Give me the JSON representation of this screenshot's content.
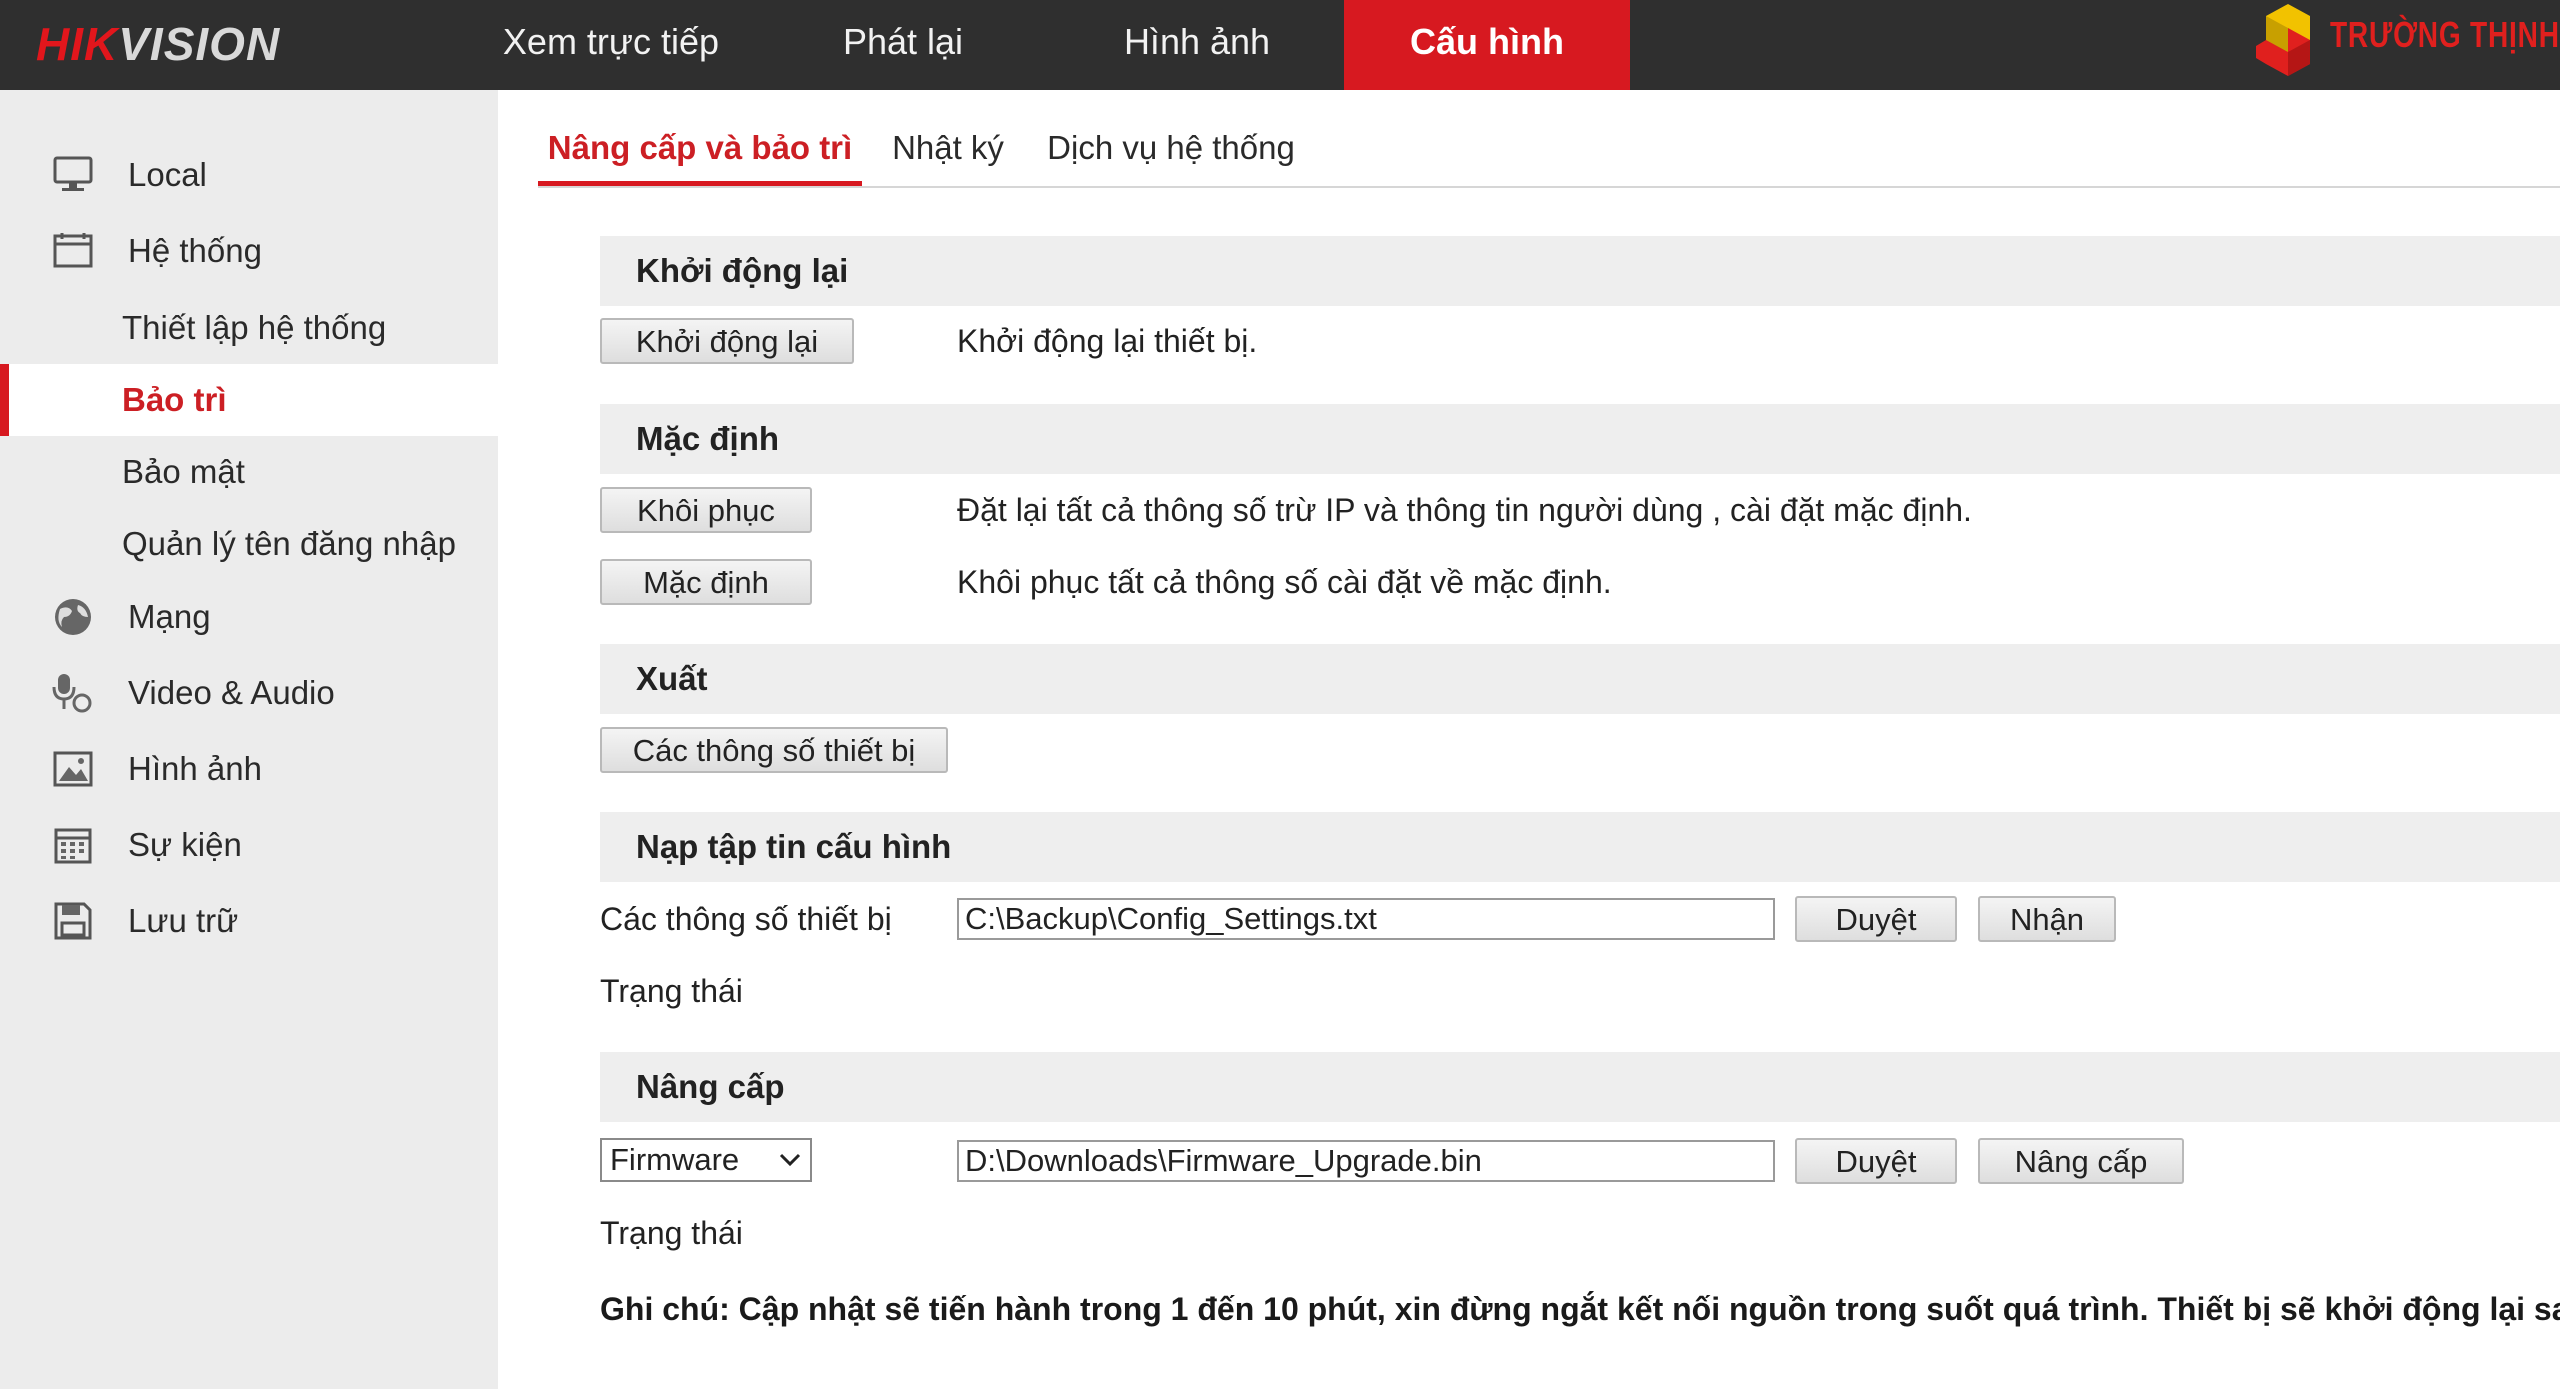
{
  "header": {
    "logo_part1": "HIK",
    "logo_part2": "VISION",
    "nav": [
      {
        "label": "Xem trực tiếp"
      },
      {
        "label": "Phát lại"
      },
      {
        "label": "Hình ảnh"
      },
      {
        "label": "Cấu hình",
        "active": true
      }
    ],
    "brand_text": "TRƯỜNG THỊNH",
    "accent_color": "#d71920"
  },
  "sidebar": {
    "items": [
      {
        "label": "Local",
        "icon": "monitor-icon"
      },
      {
        "label": "Hệ thống",
        "icon": "system-icon"
      },
      {
        "label": "Thiết lập hệ thống"
      },
      {
        "label": "Bảo trì",
        "active": true
      },
      {
        "label": "Bảo mật"
      },
      {
        "label": "Quản lý tên đăng nhập"
      },
      {
        "label": "Mạng",
        "icon": "globe-icon"
      },
      {
        "label": "Video & Audio",
        "icon": "mic-icon"
      },
      {
        "label": "Hình ảnh",
        "icon": "image-icon"
      },
      {
        "label": "Sự kiện",
        "icon": "calendar-icon"
      },
      {
        "label": "Lưu trữ",
        "icon": "storage-icon"
      }
    ]
  },
  "tabs": [
    {
      "label": "Nâng cấp và bảo trì",
      "active": true
    },
    {
      "label": "Nhật ký"
    },
    {
      "label": "Dịch vụ hệ thống"
    }
  ],
  "reboot": {
    "title": "Khởi động lại",
    "button": "Khởi động lại",
    "description": "Khởi động lại thiết bị."
  },
  "default": {
    "title": "Mặc định",
    "restore_button": "Khôi phục",
    "restore_desc": "Đặt lại tất cả thông số trừ IP và thông tin người dùng , cài đặt mặc định.",
    "default_button": "Mặc định",
    "default_desc": "Khôi phục tất cả thông số cài đặt về mặc định."
  },
  "export": {
    "title": "Xuất",
    "button": "Các thông số thiết bị"
  },
  "import": {
    "title": "Nạp tập tin cấu hình",
    "label": "Các thông số thiết bị",
    "file_value": "C:\\Backup\\Config_Settings.txt",
    "browse_button": "Duyệt",
    "import_button": "Nhận",
    "status_label": "Trạng thái"
  },
  "upgrade": {
    "title": "Nâng cấp",
    "select_value": "Firmware",
    "file_value": "D:\\Downloads\\Firmware_Upgrade.bin",
    "browse_button": "Duyệt",
    "upgrade_button": "Nâng cấp",
    "status_label": "Trạng thái"
  },
  "note": "Ghi chú: Cập nhật sẽ tiến hành trong 1 đến 10 phút, xin đừng ngắt kết nối nguồn trong suốt quá trình. Thiết bị sẽ khởi động lại sau khi cập nhật"
}
